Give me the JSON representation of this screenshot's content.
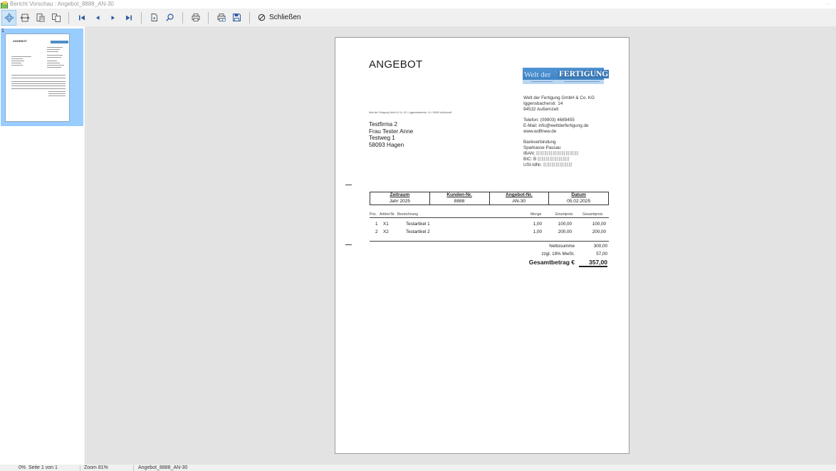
{
  "window": {
    "title": "Bericht Vorschau : Angebot_8888_AN-30"
  },
  "toolbar": {
    "buttons": [
      "move-tool",
      "zoom-fit-width",
      "zoom-page",
      "zoom-pages",
      "first-page",
      "previous-page",
      "next-page",
      "last-page",
      "page-setup",
      "search",
      "print",
      "print-setup",
      "save"
    ],
    "close_label": "Schließen",
    "accent": "#cce4f7"
  },
  "thumbnails": {
    "items": [
      {
        "number": "1",
        "title": "ANGEBOT"
      }
    ],
    "selected_color": "#99ccff"
  },
  "document": {
    "title": "ANGEBOT",
    "logo": {
      "part1": "Welt der",
      "part2": "FERTIGUNG",
      "color": "#4f94d2"
    },
    "sender_line": "Welt der Fertigung GmbH & Co. KG • Iggensbacherstr. 14 • 94532 Außernzell",
    "recipient": {
      "line1": "Testfirma 2",
      "line2": "Frau Tester Anne",
      "line3": "Testweg 1",
      "line4": "58093 Hagen"
    },
    "company": {
      "name": "Welt der Fertigung GmbH & Co. KG",
      "street": "Iggensbacherstr. 14",
      "city": "94532 Außernzell",
      "phone": "Telefon: (09903) 4689455",
      "email": "E-Mail: info@weltderfertigung.de",
      "web": "www.wdfinew.de",
      "bank_heading": "Bankverbindung",
      "bank_name": "Sparkasse Passau",
      "iban_label": "IBAN:",
      "bic_label": "BIC: B",
      "ust_label": "USt-IdNr."
    },
    "info_table": {
      "headers": [
        "Zeitraum",
        "Kunden-Nr.",
        "Angebot-Nr.",
        "Datum"
      ],
      "values": [
        "Jahr 2025",
        "8888",
        "AN-30",
        "05.02.2025"
      ]
    },
    "items_table": {
      "headers": {
        "pos": "Pos.",
        "article": "Artikel-Nr.",
        "description": "Bezeichnung",
        "qty": "Menge",
        "unit_price": "Einzelpreis",
        "total": "Gesamtpreis"
      },
      "rows": [
        {
          "pos": "1",
          "article": "X1",
          "description": "Testartikel 1",
          "qty": "1,00",
          "unit_price": "100,00",
          "total": "100,00"
        },
        {
          "pos": "2",
          "article": "X2",
          "description": "Testartikel 2",
          "qty": "1,00",
          "unit_price": "200,00",
          "total": "200,00"
        }
      ]
    },
    "totals": {
      "net_label": "Nettosumme",
      "net_value": "300,00",
      "vat_label": "zzgl. 19% MwSt.",
      "vat_value": "57,00",
      "grand_label": "Gesamtbetrag €",
      "grand_value": "357,00"
    }
  },
  "status": {
    "progress": "0%",
    "page": "Seite 1 von 1",
    "zoom": "Zoom 81%",
    "doc": "Angebot_8888_AN-30"
  }
}
